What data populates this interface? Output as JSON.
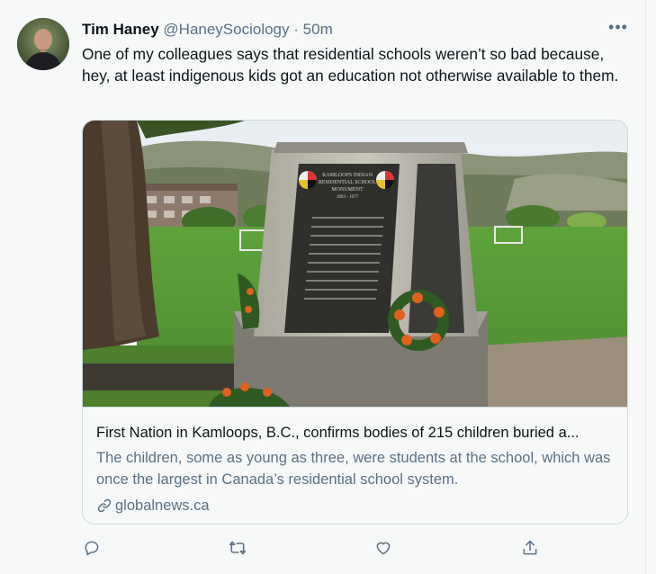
{
  "tweet": {
    "author_name": "Tim Haney",
    "author_handle": "@HaneySociology",
    "separator": "·",
    "time": "50m",
    "more_label": "•••",
    "text": "One of my colleagues says that residential schools weren’t so bad because, hey, at least indigenous kids got an education not otherwise available to them."
  },
  "card": {
    "title": "First Nation in Kamloops, B.C., confirms bodies of 215 children buried a...",
    "description": "The children, some as young as three, were students at the school, which was once the largest in Canada’s residential school system.",
    "domain": "globalnews.ca",
    "image_alt": "Kamloops Indian Residential School monument with wreaths",
    "monument_text": {
      "line1": "KAMLOOPS INDIAN",
      "line2": "RESIDENTIAL SCHOOL",
      "line3": "MONUMENT",
      "line4": "1893 - 1977"
    }
  },
  "actions": [
    {
      "name": "reply",
      "icon": "reply-icon"
    },
    {
      "name": "retweet",
      "icon": "retweet-icon"
    },
    {
      "name": "like",
      "icon": "heart-icon"
    },
    {
      "name": "share",
      "icon": "share-icon"
    }
  ],
  "colors": {
    "background": "#f7f9f9",
    "text": "#0f1419",
    "secondary": "#5b7083",
    "border": "#cfd9de"
  }
}
